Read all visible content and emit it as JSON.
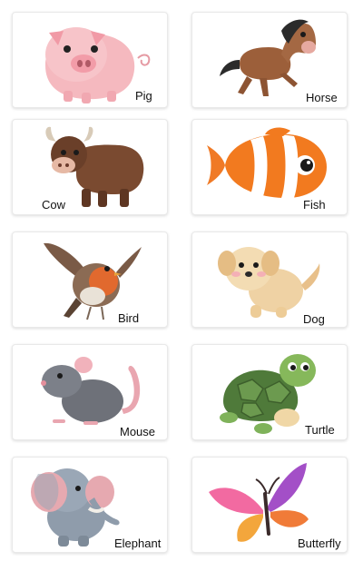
{
  "cards": [
    {
      "label": "Pig",
      "icon": "pig-icon"
    },
    {
      "label": "Horse",
      "icon": "horse-icon"
    },
    {
      "label": "Cow",
      "icon": "cow-icon"
    },
    {
      "label": "Fish",
      "icon": "clownfish-icon"
    },
    {
      "label": "Bird",
      "icon": "robin-icon"
    },
    {
      "label": "Dog",
      "icon": "puppy-icon"
    },
    {
      "label": "Mouse",
      "icon": "mouse-icon"
    },
    {
      "label": "Turtle",
      "icon": "turtle-icon"
    },
    {
      "label": "Elephant",
      "icon": "elephant-icon"
    },
    {
      "label": "Butterfly",
      "icon": "butterfly-icon"
    }
  ]
}
